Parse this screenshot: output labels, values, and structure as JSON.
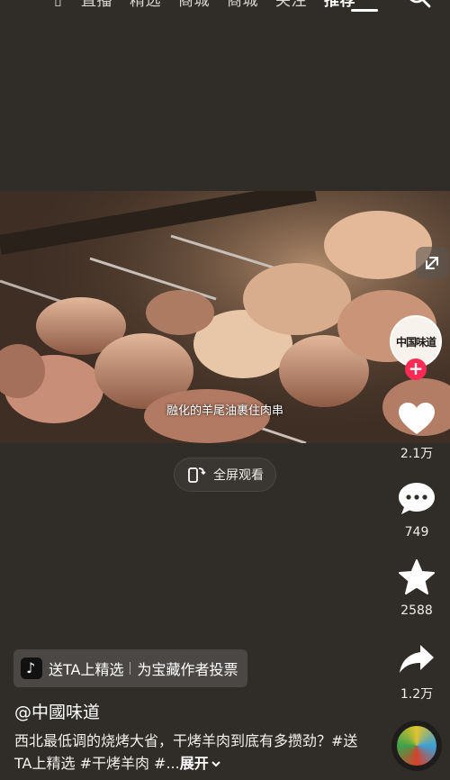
{
  "nav": {
    "tabs": [
      {
        "label": "直播"
      },
      {
        "label": "精选"
      },
      {
        "label": "商城"
      },
      {
        "label": "商城"
      },
      {
        "label": "关注"
      },
      {
        "label": "推荐"
      }
    ],
    "active_tab": "推荐"
  },
  "video": {
    "subtitle": "融化的羊尾油裹住肉串",
    "fullscreen_label": "全屏观看"
  },
  "creator": {
    "avatar_text": "中国味道"
  },
  "actions": {
    "likes": "2.1万",
    "comments": "749",
    "favorites": "2588",
    "shares": "1.2万"
  },
  "badge": {
    "primary": "送TA上精选",
    "secondary": "为宝藏作者投票"
  },
  "post": {
    "author": "@中國味道",
    "description": "西北最低调的烧烤大省，干烤羊肉到底有多攒劲？#送TA上精选 #干烤羊肉 #...",
    "expand_label": "展开"
  },
  "colors": {
    "background": "#302d29",
    "follow_accent": "#fe2c55"
  }
}
